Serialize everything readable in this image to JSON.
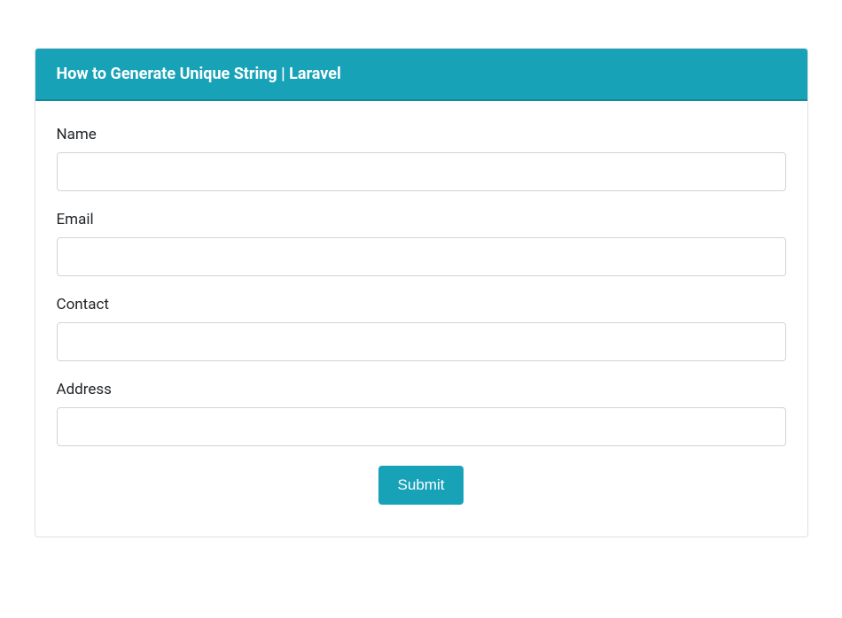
{
  "header": {
    "title": "How to Generate Unique String | Laravel"
  },
  "form": {
    "fields": {
      "name": {
        "label": "Name",
        "value": ""
      },
      "email": {
        "label": "Email",
        "value": ""
      },
      "contact": {
        "label": "Contact",
        "value": ""
      },
      "address": {
        "label": "Address",
        "value": ""
      }
    },
    "submit_label": "Submit"
  },
  "colors": {
    "accent": "#17a2b8"
  }
}
